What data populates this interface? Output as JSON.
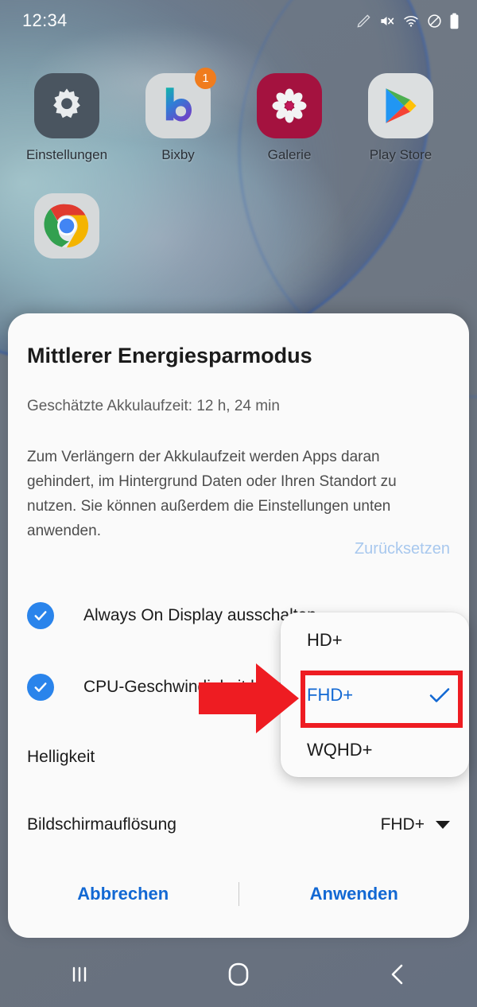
{
  "status_bar": {
    "time": "12:34",
    "icons": [
      "pencil-icon",
      "mute-icon",
      "wifi-icon",
      "do-not-disturb-icon",
      "battery-icon"
    ]
  },
  "home_screen": {
    "apps_row1": [
      {
        "label": "Einstellungen",
        "icon": "settings-gear-icon",
        "badge": ""
      },
      {
        "label": "Bixby",
        "icon": "bixby-icon",
        "badge": "1"
      },
      {
        "label": "Galerie",
        "icon": "gallery-flower-icon",
        "badge": ""
      },
      {
        "label": "Play Store",
        "icon": "play-store-icon",
        "badge": ""
      }
    ],
    "apps_row2": [
      {
        "label": "",
        "icon": "chrome-icon",
        "badge": ""
      }
    ]
  },
  "dialog": {
    "title": "Mittlerer Energiesparmodus",
    "subtitle": "Geschätzte Akkulaufzeit: 12 h, 24 min",
    "body": "Zum Verlängern der Akkulaufzeit werden Apps daran gehindert, im Hintergrund Daten oder Ihren Standort zu nutzen. Sie können außerdem die Einstellungen unten anwenden.",
    "reset_label": "Zurücksetzen",
    "checkboxes": [
      {
        "label": "Always On Display ausschalten",
        "checked": true
      },
      {
        "label": "CPU-Geschwindigkeit begrenzen",
        "checked": true
      }
    ],
    "settings": [
      {
        "label": "Helligkeit",
        "value": ""
      },
      {
        "label": "Bildschirmauflösung",
        "value": "FHD+"
      }
    ],
    "cancel_label": "Abbrechen",
    "apply_label": "Anwenden"
  },
  "dropdown": {
    "items": [
      {
        "label": "HD+",
        "selected": false
      },
      {
        "label": "FHD+",
        "selected": true
      },
      {
        "label": "WQHD+",
        "selected": false
      }
    ]
  },
  "annotations": {
    "highlight_color": "#ee1c22",
    "arrow": "red-arrow-right",
    "target": "FHD+"
  },
  "nav_bar": {
    "buttons": [
      "recents-icon",
      "home-icon",
      "back-icon"
    ]
  },
  "colors": {
    "accent_blue": "#1268d3",
    "checkbox_blue": "#2a84eb",
    "annotation_red": "#ee1c22",
    "badge_orange": "#f07c1d"
  }
}
